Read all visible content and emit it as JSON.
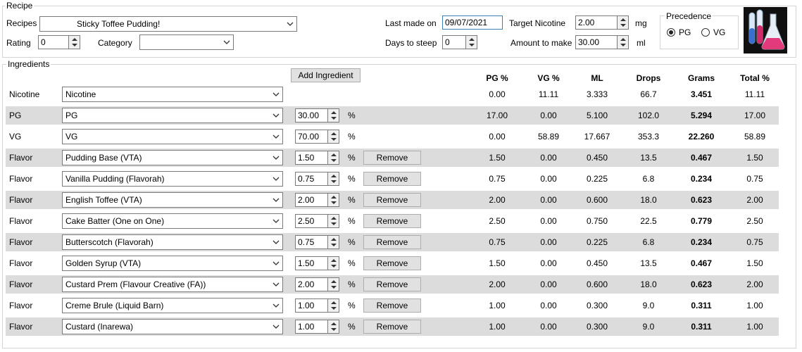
{
  "recipe": {
    "legend": "Recipe",
    "recipes_label": "Recipes",
    "recipe_name": "Sticky Toffee Pudding!",
    "rating_label": "Rating",
    "rating_value": "0",
    "category_label": "Category",
    "category_value": "",
    "last_made_label": "Last made on",
    "last_made_value": "09/07/2021",
    "days_label": "Days to steep",
    "days_value": "0",
    "target_nic_label": "Target Nicotine",
    "target_nic_value": "2.00",
    "target_nic_unit": "mg",
    "amount_label": "Amount to make",
    "amount_value": "30.00",
    "amount_unit": "ml",
    "precedence_legend": "Precedence",
    "pg_label": "PG",
    "vg_label": "VG",
    "precedence_selected": "PG"
  },
  "ingredients": {
    "legend": "Ingredients",
    "add_button": "Add Ingredient",
    "remove_label": "Remove",
    "percent_sign": "%",
    "headers": [
      "PG %",
      "VG %",
      "ML",
      "Drops",
      "Grams",
      "Total %"
    ],
    "rows": [
      {
        "type": "Nicotine",
        "name": "Nicotine",
        "pct": null,
        "removable": false,
        "pg": "0.00",
        "vg": "11.11",
        "ml": "3.333",
        "drops": "66.7",
        "grams": "3.451",
        "total": "11.11",
        "shade": false
      },
      {
        "type": "PG",
        "name": "PG",
        "pct": "30.00",
        "removable": false,
        "pg": "17.00",
        "vg": "0.00",
        "ml": "5.100",
        "drops": "102.0",
        "grams": "5.294",
        "total": "17.00",
        "shade": true
      },
      {
        "type": "VG",
        "name": "VG",
        "pct": "70.00",
        "removable": false,
        "pg": "0.00",
        "vg": "58.89",
        "ml": "17.667",
        "drops": "353.3",
        "grams": "22.260",
        "total": "58.89",
        "shade": false
      },
      {
        "type": "Flavor",
        "name": "Pudding Base (VTA)",
        "pct": "1.50",
        "removable": true,
        "pg": "1.50",
        "vg": "0.00",
        "ml": "0.450",
        "drops": "13.5",
        "grams": "0.467",
        "total": "1.50",
        "shade": true
      },
      {
        "type": "Flavor",
        "name": "Vanilla Pudding (Flavorah)",
        "pct": "0.75",
        "removable": true,
        "pg": "0.75",
        "vg": "0.00",
        "ml": "0.225",
        "drops": "6.8",
        "grams": "0.234",
        "total": "0.75",
        "shade": false
      },
      {
        "type": "Flavor",
        "name": "English Toffee (VTA)",
        "pct": "2.00",
        "removable": true,
        "pg": "2.00",
        "vg": "0.00",
        "ml": "0.600",
        "drops": "18.0",
        "grams": "0.623",
        "total": "2.00",
        "shade": true
      },
      {
        "type": "Flavor",
        "name": "Cake Batter (One on One)",
        "pct": "2.50",
        "removable": true,
        "pg": "2.50",
        "vg": "0.00",
        "ml": "0.750",
        "drops": "22.5",
        "grams": "0.779",
        "total": "2.50",
        "shade": false
      },
      {
        "type": "Flavor",
        "name": "Butterscotch (Flavorah)",
        "pct": "0.75",
        "removable": true,
        "pg": "0.75",
        "vg": "0.00",
        "ml": "0.225",
        "drops": "6.8",
        "grams": "0.234",
        "total": "0.75",
        "shade": true
      },
      {
        "type": "Flavor",
        "name": "Golden Syrup (VTA)",
        "pct": "1.50",
        "removable": true,
        "pg": "1.50",
        "vg": "0.00",
        "ml": "0.450",
        "drops": "13.5",
        "grams": "0.467",
        "total": "1.50",
        "shade": false
      },
      {
        "type": "Flavor",
        "name": "Custard Prem (Flavour Creative (FA))",
        "pct": "2.00",
        "removable": true,
        "pg": "2.00",
        "vg": "0.00",
        "ml": "0.600",
        "drops": "18.0",
        "grams": "0.623",
        "total": "2.00",
        "shade": true
      },
      {
        "type": "Flavor",
        "name": "Creme Brule (Liquid Barn)",
        "pct": "1.00",
        "removable": true,
        "pg": "1.00",
        "vg": "0.00",
        "ml": "0.300",
        "drops": "9.0",
        "grams": "0.311",
        "total": "1.00",
        "shade": false
      },
      {
        "type": "Flavor",
        "name": "Custard (Inarewa)",
        "pct": "1.00",
        "removable": true,
        "pg": "1.00",
        "vg": "0.00",
        "ml": "0.300",
        "drops": "9.0",
        "grams": "0.311",
        "total": "1.00",
        "shade": true
      }
    ]
  },
  "colors": {
    "row_shade": "#dcdcdc",
    "window_bg": "#ffffff",
    "input_border": "#7a7a7a",
    "focus_border": "#3c7fb1"
  },
  "icons": {
    "logo": "lab-flasks-icon",
    "dropdown": "chevron-down-icon",
    "spinner": "spinner-arrows-icon"
  }
}
